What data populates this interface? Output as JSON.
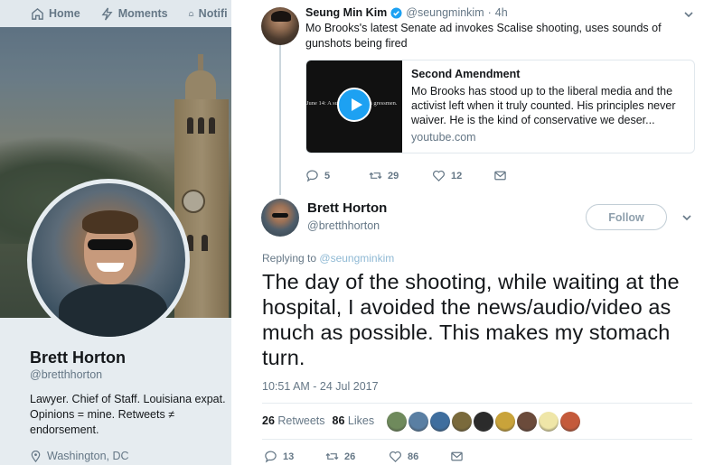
{
  "background": {
    "nav": {
      "home": "Home",
      "moments": "Moments",
      "notifications": "Notifi"
    },
    "profile": {
      "name": "Brett Horton",
      "handle": "@bretthhorton",
      "bio": "Lawyer. Chief of Staff. Louisiana expat. Opinions = mine. Retweets ≠ endorsement.",
      "location": "Washington, DC"
    }
  },
  "quoted_tweet": {
    "author_name": "Seung Min Kim",
    "author_handle": "@seungminkim",
    "separator": "·",
    "time": "4h",
    "text": "Mo Brooks's latest Senate ad invokes Scalise shooting, uses sounds of gunshots being fired",
    "card": {
      "thumb_text": "June 14: A  supporte fires on   gressmen.",
      "title": "Second Amendment",
      "description": "Mo Brooks has stood up to the liberal media and the activist left when it truly counted. His principles never waiver. He is the kind of conservative we deser...",
      "url": "youtube.com"
    },
    "actions": {
      "replies": "5",
      "retweets": "29",
      "likes": "12"
    }
  },
  "main_tweet": {
    "author_name": "Brett Horton",
    "author_handle": "@bretthhorton",
    "follow_label": "Follow",
    "replying_prefix": "Replying to",
    "replying_to": "@seungminkim",
    "text": "The day of the shooting, while waiting at the hospital, I avoided the news/audio/video as much as possible. This makes my stomach turn.",
    "timestamp": "10:51 AM - 24 Jul 2017",
    "stats": {
      "retweets_count": "26",
      "retweets_label": "Retweets",
      "likes_count": "86",
      "likes_label": "Likes"
    },
    "liker_colors": [
      "#6f8a5c",
      "#5a7fa3",
      "#3f6e9e",
      "#7a6a3c",
      "#2b2b2b",
      "#c9a33a",
      "#6b4b3b",
      "#efe6a8",
      "#c45a3b"
    ],
    "actions": {
      "replies": "13",
      "retweets": "26",
      "likes": "86"
    }
  },
  "colors": {
    "accent": "#1da1f2",
    "muted": "#657786",
    "divider": "#e6ecf0"
  },
  "icons": {
    "home": "home-icon",
    "moments": "lightning-icon",
    "notifications": "bell-icon",
    "verified": "verified-badge-icon",
    "reply": "reply-icon",
    "retweet": "retweet-icon",
    "like": "heart-icon",
    "message": "envelope-icon",
    "more": "chevron-down-icon",
    "location": "location-pin-icon"
  }
}
